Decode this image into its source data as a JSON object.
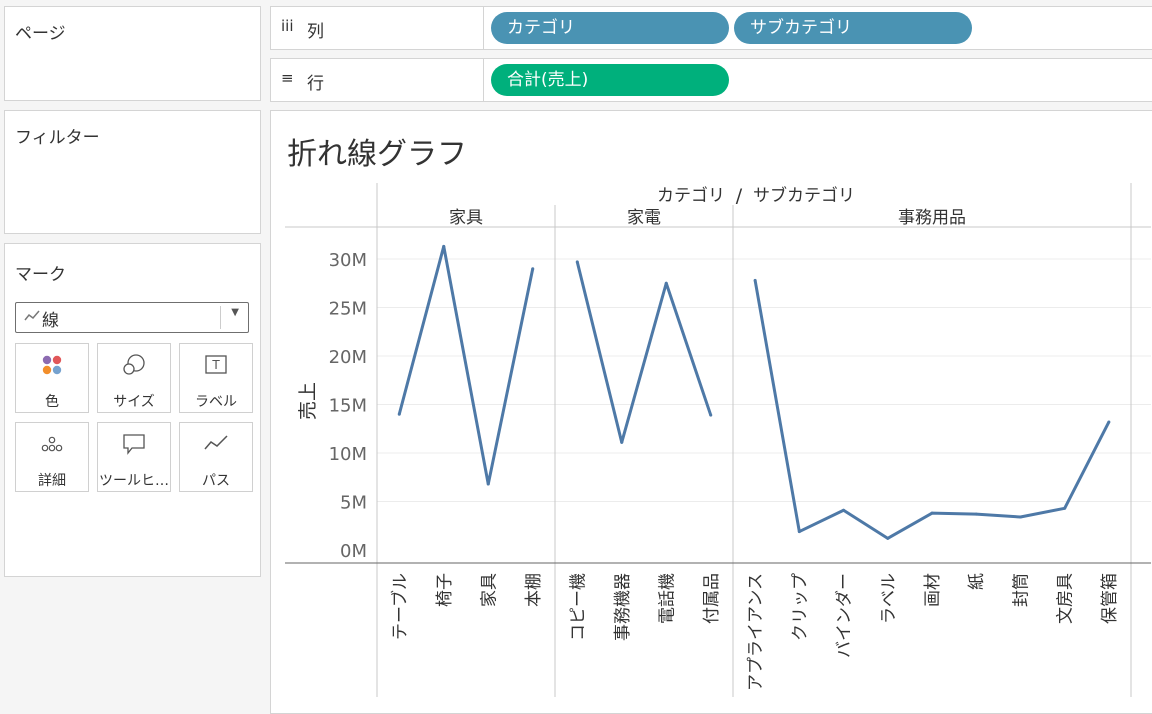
{
  "pages_panel": {
    "title": "ページ"
  },
  "filters_panel": {
    "title": "フィルター"
  },
  "marks_panel": {
    "title": "マーク",
    "mark_type": "線",
    "cards": [
      {
        "label": "色",
        "icon": "color-dots-icon"
      },
      {
        "label": "サイズ",
        "icon": "size-circles-icon"
      },
      {
        "label": "ラベル",
        "icon": "text-label-icon"
      },
      {
        "label": "詳細",
        "icon": "detail-dots-icon"
      },
      {
        "label": "ツールヒ…",
        "icon": "tooltip-bubble-icon"
      },
      {
        "label": "パス",
        "icon": "path-line-icon"
      }
    ]
  },
  "columns_shelf": {
    "icon": "iii",
    "label": "列",
    "pills": [
      "カテゴリ",
      "サブカテゴリ"
    ]
  },
  "rows_shelf": {
    "icon": "≡",
    "label": "行",
    "pills": [
      "合計(売上)"
    ]
  },
  "colors": {
    "dimension_pill": "#4a93b3",
    "measure_pill": "#00b07c",
    "line": "#4e79a7"
  },
  "worksheet": {
    "title": "折れ線グラフ",
    "header": {
      "left": "カテゴリ",
      "separator": "/",
      "right": "サブカテゴリ"
    }
  },
  "chart_data": {
    "type": "line",
    "ylabel": "売上",
    "ylim": [
      0,
      30000000
    ],
    "yticks": [
      {
        "value": 0,
        "label": "0M"
      },
      {
        "value": 5000000,
        "label": "5M"
      },
      {
        "value": 10000000,
        "label": "10M"
      },
      {
        "value": 15000000,
        "label": "15M"
      },
      {
        "value": 20000000,
        "label": "20M"
      },
      {
        "value": 25000000,
        "label": "25M"
      },
      {
        "value": 30000000,
        "label": "30M"
      }
    ],
    "gridlines": true,
    "panes": [
      {
        "name": "家具",
        "categories": [
          "テーブル",
          "椅子",
          "家具",
          "本棚"
        ],
        "values": [
          14000000,
          31300000,
          6800000,
          29000000
        ]
      },
      {
        "name": "家電",
        "categories": [
          "コピー機",
          "事務機器",
          "電話機",
          "付属品"
        ],
        "values": [
          29700000,
          11100000,
          27500000,
          13900000
        ]
      },
      {
        "name": "事務用品",
        "categories": [
          "アプライアンス",
          "クリップ",
          "バインダー",
          "ラベル",
          "画材",
          "紙",
          "封筒",
          "文房具",
          "保管箱"
        ],
        "values": [
          27800000,
          1900000,
          4100000,
          1200000,
          3800000,
          3700000,
          3400000,
          4300000,
          13200000
        ]
      }
    ]
  }
}
